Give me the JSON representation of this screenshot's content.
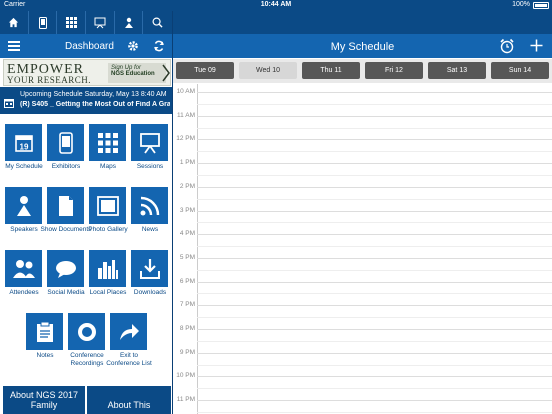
{
  "status": {
    "carrier": "Carrier",
    "time": "10:44 AM",
    "battery": "100%"
  },
  "topicons": [
    "home-icon",
    "phone-icon",
    "grid-icon",
    "presentation-icon",
    "speaker-icon",
    "search-icon"
  ],
  "left_header": {
    "title": "Dashboard"
  },
  "right_header": {
    "title": "My Schedule"
  },
  "banner": {
    "line1": "EMPOWER",
    "line2": "YOUR RESEARCH.",
    "cta1": "Sign Up for",
    "cta2": "NGS Education"
  },
  "upcoming": {
    "line1": "Upcoming Schedule Saturday, May 13 8:40 AM",
    "line2": "(R) S405 _ Getting the Most Out of Find A Gra..."
  },
  "tiles": [
    {
      "label": "My Schedule",
      "icon": "calendar-icon"
    },
    {
      "label": "Exhibitors",
      "icon": "phone-icon"
    },
    {
      "label": "Maps",
      "icon": "grid-icon"
    },
    {
      "label": "Sessions",
      "icon": "presentation-icon"
    },
    {
      "label": "Speakers",
      "icon": "speaker-icon"
    },
    {
      "label": "Show Documents",
      "icon": "document-icon"
    },
    {
      "label": "Photo Gallery",
      "icon": "photo-icon"
    },
    {
      "label": "News",
      "icon": "rss-icon"
    },
    {
      "label": "Attendees",
      "icon": "people-icon"
    },
    {
      "label": "Social Media",
      "icon": "chat-icon"
    },
    {
      "label": "Local Places",
      "icon": "city-icon"
    },
    {
      "label": "Downloads",
      "icon": "download-icon"
    },
    {
      "label": "Notes",
      "icon": "clipboard-icon"
    },
    {
      "label": "Conference Recordings",
      "icon": "record-icon"
    },
    {
      "label": "Exit to Conference List",
      "icon": "share-arrow-icon"
    }
  ],
  "about_buttons": [
    "About NGS 2017 Family",
    "About This"
  ],
  "days": [
    "Tue 09",
    "Wed 10",
    "Thu 11",
    "Fri 12",
    "Sat 13",
    "Sun 14"
  ],
  "selected_day": "Wed 10",
  "hours": [
    "10 AM",
    "11 AM",
    "12 PM",
    "1 PM",
    "2 PM",
    "3 PM",
    "4 PM",
    "5 PM",
    "6 PM",
    "7 PM",
    "8 PM",
    "9 PM",
    "10 PM",
    "11 PM"
  ]
}
